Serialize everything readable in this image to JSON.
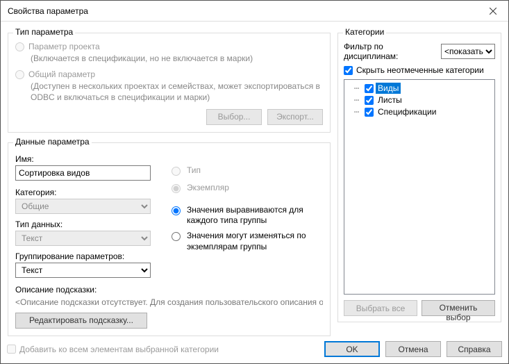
{
  "window": {
    "title": "Свойства параметра"
  },
  "paramType": {
    "legend": "Тип параметра",
    "project": {
      "label": "Параметр проекта",
      "hint": "(Включается в спецификации, но не включается в марки)"
    },
    "shared": {
      "label": "Общий параметр",
      "hint": "(Доступен в нескольких проектах и семействах, может экспортироваться в ODBC и включаться в спецификации и марки)"
    },
    "buttons": {
      "choose": "Выбор...",
      "export": "Экспорт..."
    }
  },
  "paramData": {
    "legend": "Данные параметра",
    "nameLabel": "Имя:",
    "nameValue": "Сортировка видов",
    "categoryLabel": "Категория:",
    "categoryValue": "Общие",
    "dataTypeLabel": "Тип данных:",
    "dataTypeValue": "Текст",
    "groupingLabel": "Группирование параметров:",
    "groupingValue": "Текст",
    "typeLabel": "Тип",
    "instanceLabel": "Экземпляр",
    "alignLabel": "Значения выравниваются для каждого типа группы",
    "varyLabel": "Значения могут изменяться по экземплярам группы",
    "tooltipLabel": "Описание подсказки:",
    "tooltipText": "<Описание подсказки отсутствует. Для создания пользовательского описания отр...",
    "editTooltip": "Редактировать подсказку..."
  },
  "categories": {
    "legend": "Категории",
    "filterLabel": "Фильтр по дисциплинам:",
    "filterValue": "<показать",
    "hideUnchecked": "Скрыть неотмеченные категории",
    "items": [
      {
        "label": "Виды",
        "checked": true,
        "selected": true
      },
      {
        "label": "Листы",
        "checked": true,
        "selected": false
      },
      {
        "label": "Спецификации",
        "checked": true,
        "selected": false
      }
    ],
    "selectAll": "Выбрать все",
    "deselectAll": "Отменить выбор"
  },
  "footer": {
    "addToAll": "Добавить ко всем элементам выбранной категории",
    "ok": "OK",
    "cancel": "Отмена",
    "help": "Справка"
  }
}
